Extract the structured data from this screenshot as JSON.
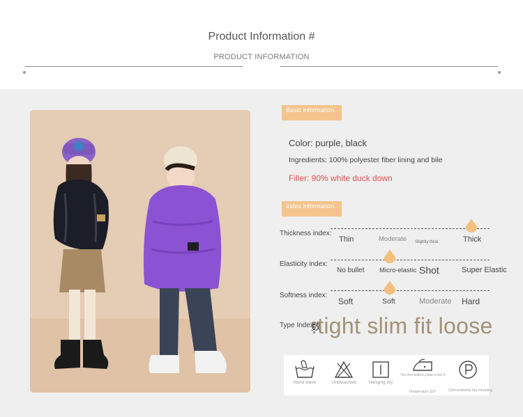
{
  "header": {
    "title": "Product Information #",
    "subtitle": "PRODUCT INFORMATION"
  },
  "basic": {
    "tag": "Basic information",
    "color": "Color: purple, black",
    "ingredients": "Ingredients: 100% polyester fiber lining and bile",
    "filler": "Filler: 90% white duck down"
  },
  "index": {
    "tag": "Index information",
    "thickness": {
      "label": "Thickness index:",
      "options": [
        "Thin",
        "Moderate",
        "Slightly thick",
        "Thick"
      ]
    },
    "elasticity": {
      "label": "Elasticity index:",
      "options": [
        "No bullet",
        "Micro-elastic",
        "Shot",
        "Super Elastic"
      ]
    },
    "softness": {
      "label": "Softness index:",
      "options": [
        "Soft",
        "Soft",
        "Moderate",
        "Hard"
      ]
    },
    "type": {
      "label": "Type Index:",
      "glyph": "数",
      "options": ":tight slim fit loose"
    }
  },
  "care": [
    {
      "icon": "handwash-icon",
      "label": "Hand wash"
    },
    {
      "icon": "no-bleach-icon",
      "label": "Unbleached"
    },
    {
      "icon": "hang-dry-icon",
      "label": "Hanging dry"
    },
    {
      "icon": "iron-icon",
      "label": "The iron bottom plate is the h",
      "label2": "Temperature 110°"
    },
    {
      "icon": "dry-clean-icon",
      "label": "Conventional dry cleaning"
    }
  ],
  "colors": {
    "tag_bg": "#f5c48d",
    "marker": "#f2c17e",
    "filler_text": "#d9534f",
    "type_text": "#a39178",
    "panel_bg": "#efefef"
  }
}
